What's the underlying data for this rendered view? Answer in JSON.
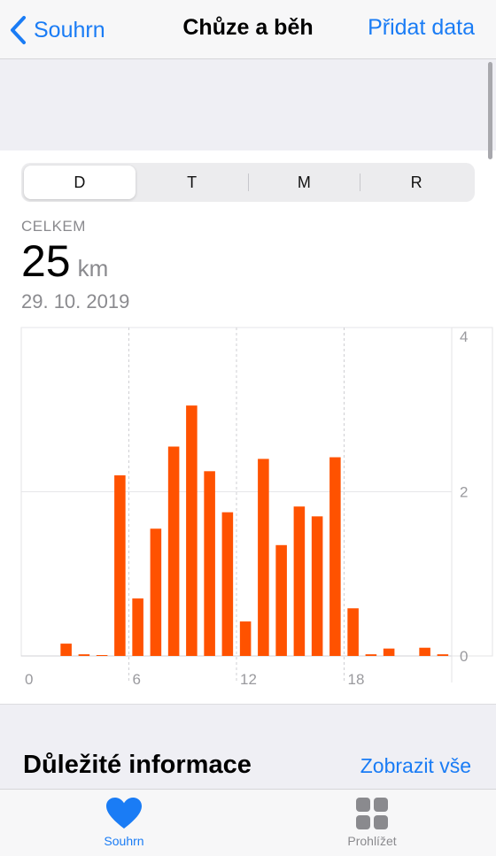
{
  "nav": {
    "back_label": "Souhrn",
    "title": "Chůze a běh",
    "action_label": "Přidat data"
  },
  "segments": [
    {
      "label": "D",
      "active": true
    },
    {
      "label": "T",
      "active": false
    },
    {
      "label": "M",
      "active": false
    },
    {
      "label": "R",
      "active": false
    }
  ],
  "summary": {
    "label": "CELKEM",
    "value": "25",
    "unit": "km",
    "date": "29. 10. 2019"
  },
  "chart_data": {
    "type": "bar",
    "x": [
      0,
      1,
      2,
      3,
      4,
      5,
      6,
      7,
      8,
      9,
      10,
      11,
      12,
      13,
      14,
      15,
      16,
      17,
      18,
      19,
      20,
      21,
      22,
      23
    ],
    "values": [
      0,
      0,
      0.15,
      0.02,
      0.01,
      2.2,
      0.7,
      1.55,
      2.55,
      3.05,
      2.25,
      1.75,
      0.42,
      2.4,
      1.35,
      1.82,
      1.7,
      2.42,
      0.58,
      0.02,
      0.09,
      0,
      0.1,
      0.02
    ],
    "x_ticks": [
      "0",
      "6",
      "12",
      "18"
    ],
    "y_ticks": [
      "0",
      "2",
      "4"
    ],
    "ylim": [
      0,
      4
    ],
    "xlim": [
      0,
      24
    ],
    "bar_color": "#ff5200",
    "grid": true
  },
  "info": {
    "title": "Důležité informace",
    "action_label": "Zobrazit vše"
  },
  "tabs": [
    {
      "label": "Souhrn",
      "icon": "heart-icon",
      "active": true
    },
    {
      "label": "Prohlížet",
      "icon": "grid-icon",
      "active": false
    }
  ],
  "colors": {
    "accent": "#1a7cf5",
    "bar": "#ff5200",
    "secondary_text": "#8a8a8e"
  }
}
